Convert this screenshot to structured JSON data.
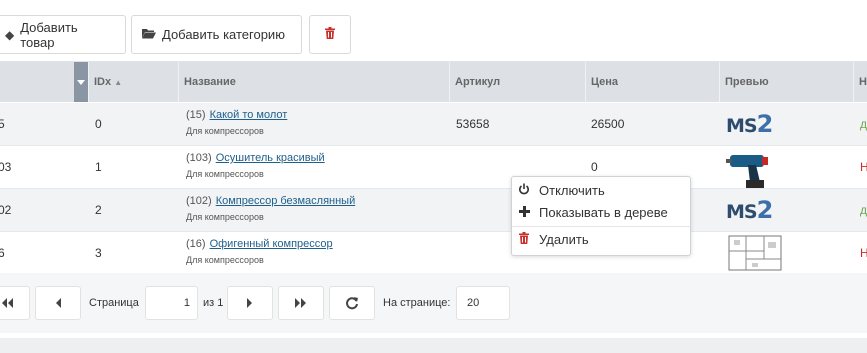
{
  "toolbar": {
    "add_product": "Добавить товар",
    "add_category": "Добавить категорию"
  },
  "table": {
    "columns": [
      "IDx",
      "Название",
      "Артикул",
      "Цена",
      "Превью"
    ],
    "sort_glyph": "▲",
    "cut_header": "Н",
    "rows": [
      {
        "id": "5",
        "idx": "0",
        "num": "(15)",
        "name": "Какой то молот",
        "cat": "Для компрессоров",
        "article": "53658",
        "price": "26500",
        "preview": "ms2-logo",
        "flag": "д",
        "flag_color": "#6aa84f"
      },
      {
        "id": "03",
        "idx": "1",
        "num": "(103)",
        "name": "Осушитель красивый",
        "cat": "Для компрессоров",
        "article": "",
        "price": "0",
        "preview": "drill-photo",
        "flag": "Н",
        "flag_color": "#cc2b2b"
      },
      {
        "id": "02",
        "idx": "2",
        "num": "(102)",
        "name": "Компрессор безмаслянный",
        "cat": "Для компрессоров",
        "article": "",
        "price": "",
        "preview": "ms2-logo",
        "flag": "д",
        "flag_color": "#6aa84f"
      },
      {
        "id": "6",
        "idx": "3",
        "num": "(16)",
        "name": "Офигенный компрессор",
        "cat": "Для компрессоров",
        "article": "",
        "price": "",
        "preview": "floorplan",
        "flag": "Н",
        "flag_color": "#cc2b2b"
      }
    ]
  },
  "logo_text": {
    "ms": "MS",
    "two": "2"
  },
  "pagination": {
    "page_label": "Страница",
    "page_value": "1",
    "of_label": "из 1",
    "per_page_label": "На странице:",
    "per_page_value": "20"
  },
  "context_menu": {
    "items": [
      {
        "label": "Отключить",
        "icon": "power-icon"
      },
      {
        "label": "Показывать в дереве",
        "icon": "plus-icon"
      },
      {
        "label": "Удалить",
        "icon": "trash-icon"
      }
    ]
  },
  "colors": {
    "accent_link": "#1f5f8b",
    "header_bg": "#dde1e6",
    "trash_red": "#cc2b2b"
  }
}
